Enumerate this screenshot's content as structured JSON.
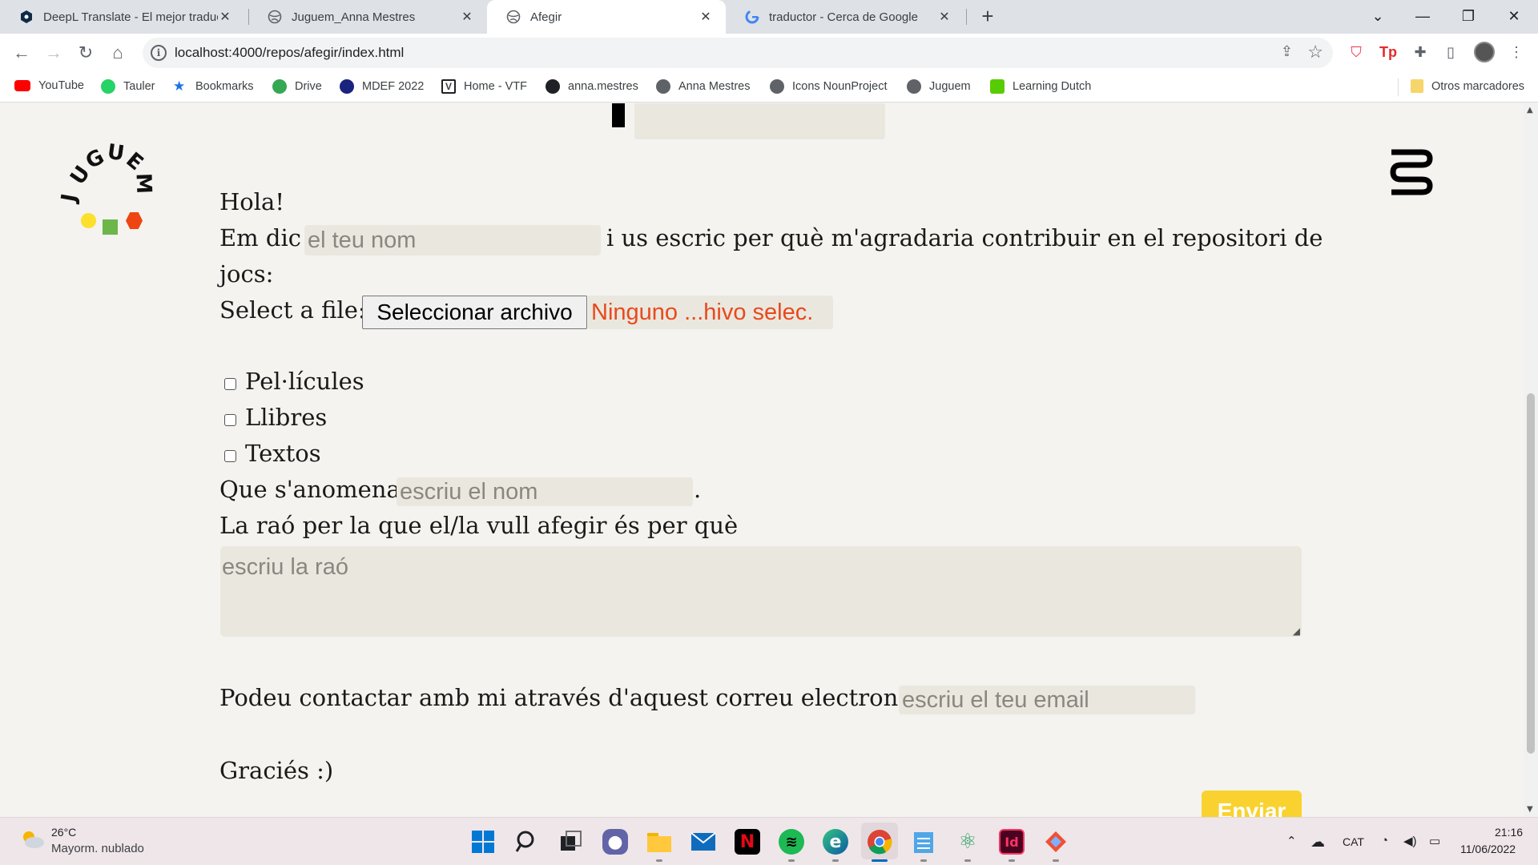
{
  "browser": {
    "tabs": [
      {
        "title": "DeepL Translate - El mejor traduc",
        "icon": "deepl-icon",
        "active": false
      },
      {
        "title": "Juguem_Anna Mestres",
        "icon": "globe-icon",
        "active": false
      },
      {
        "title": "Afegir",
        "icon": "globe-icon",
        "active": true
      },
      {
        "title": "traductor - Cerca de Google",
        "icon": "google-icon",
        "active": false
      }
    ],
    "url": "localhost:4000/repos/afegir/index.html",
    "bookmarks": [
      {
        "label": "YouTube",
        "icon": "youtube-icon",
        "color": "#ff0000"
      },
      {
        "label": "Tauler",
        "icon": "whatsapp-icon",
        "color": "#25d366"
      },
      {
        "label": "Bookmarks",
        "icon": "star-icon",
        "color": "#1a73e8"
      },
      {
        "label": "Drive",
        "icon": "drive-icon",
        "color": "#34a853"
      },
      {
        "label": "MDEF 2022",
        "icon": "mdef-icon",
        "color": "#1a237e"
      },
      {
        "label": "Home - VTF",
        "icon": "vtf-icon",
        "color": "#202124"
      },
      {
        "label": "anna.mestres",
        "icon": "github-icon",
        "color": "#202124"
      },
      {
        "label": "Anna Mestres",
        "icon": "globe-icon",
        "color": "#5f6368"
      },
      {
        "label": "Icons NounProject",
        "icon": "globe-icon",
        "color": "#5f6368"
      },
      {
        "label": "Juguem",
        "icon": "globe-icon",
        "color": "#5f6368"
      },
      {
        "label": "Learning Dutch",
        "icon": "duolingo-icon",
        "color": "#58cc02"
      }
    ],
    "other_bookmarks": "Otros marcadores"
  },
  "page": {
    "logo_letters": [
      "J",
      "U",
      "G",
      "U",
      "E",
      "M"
    ],
    "logo_colors": {
      "yellow": "#fce02b",
      "green": "#6cb64a",
      "red": "#ee4512"
    },
    "greeting": "Hola!",
    "intro_before": "Em dic",
    "name_placeholder": "el teu nom",
    "intro_after": "i us escric per què m'agradaria contribuir en el repositori de",
    "intro_line2": "jocs:",
    "file_label": "Select a file:",
    "file_button": "Seleccionar archivo",
    "file_status": "Ninguno ...hivo selec.",
    "categories": [
      "Pel·lícules",
      "Llibres",
      "Textos"
    ],
    "title_label": "Que s'anomena",
    "title_placeholder": "escriu el nom",
    "period": ".",
    "reason_label": "La raó per la que el/la vull afegir és per què",
    "reason_placeholder": "escriu la raó",
    "contact_label": "Podeu contactar amb mi através d'aquest correu electronic:",
    "email_placeholder": "escriu el teu email",
    "thanks": "Graciés :)",
    "submit": "Enviar",
    "accent_color": "#f9d230"
  },
  "taskbar": {
    "weather_temp": "26°C",
    "weather_desc": "Mayorm. nublado",
    "language": "CAT",
    "time": "21:16",
    "date": "11/06/2022"
  }
}
